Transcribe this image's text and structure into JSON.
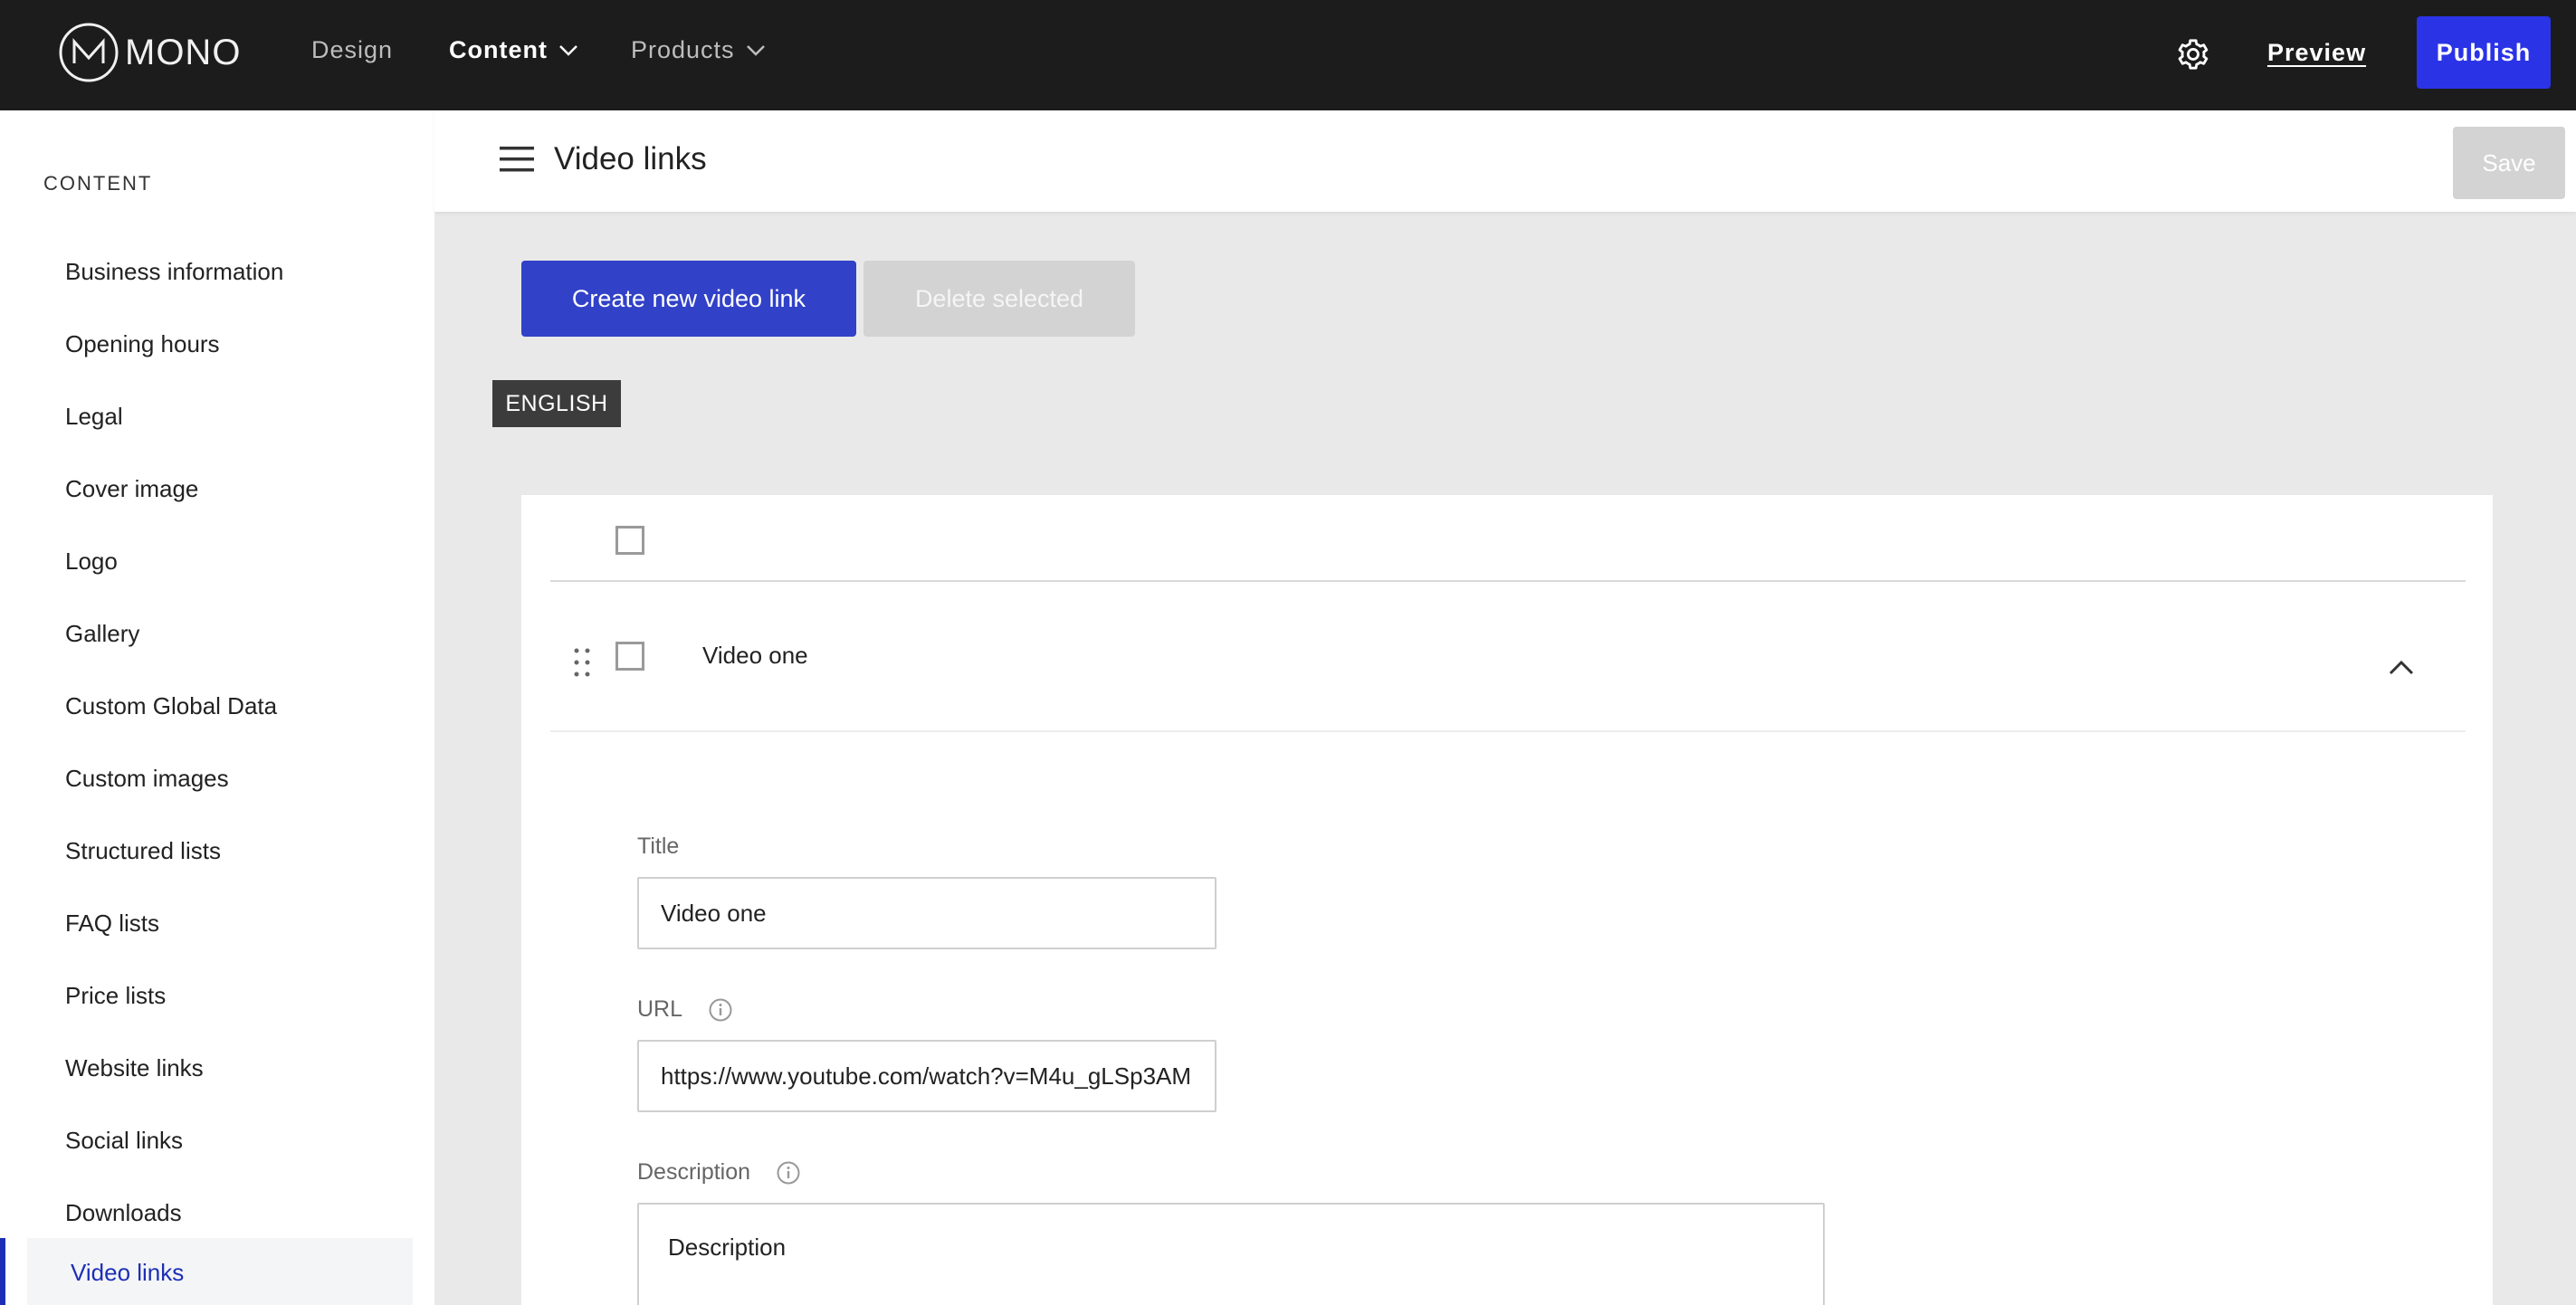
{
  "topbar": {
    "logo_text": "MONO",
    "nav": [
      {
        "label": "Design",
        "active": false,
        "dropdown": false
      },
      {
        "label": "Content",
        "active": true,
        "dropdown": true
      },
      {
        "label": "Products",
        "active": false,
        "dropdown": true
      }
    ],
    "settings_icon": "gear-icon",
    "preview_label": "Preview",
    "publish_label": "Publish",
    "publish_color": "#2b33e6"
  },
  "sidebar": {
    "heading": "CONTENT",
    "items": [
      {
        "label": "Business information"
      },
      {
        "label": "Opening hours"
      },
      {
        "label": "Legal"
      },
      {
        "label": "Cover image"
      },
      {
        "label": "Logo"
      },
      {
        "label": "Gallery"
      },
      {
        "label": "Custom Global Data"
      },
      {
        "label": "Custom images"
      },
      {
        "label": "Structured lists"
      },
      {
        "label": "FAQ lists"
      },
      {
        "label": "Price lists"
      },
      {
        "label": "Website links"
      },
      {
        "label": "Social links"
      },
      {
        "label": "Downloads"
      },
      {
        "label": "Video links",
        "active": true
      }
    ],
    "active_color": "#1d2fb5"
  },
  "header": {
    "title": "Video links",
    "save_label": "Save"
  },
  "actions": {
    "create_label": "Create new video link",
    "delete_label": "Delete selected",
    "create_color": "#3141c8"
  },
  "language_tab": "ENGLISH",
  "video_item": {
    "title": "Video one",
    "fields": {
      "title_label": "Title",
      "title_value": "Video one",
      "url_label": "URL",
      "url_value": "https://www.youtube.com/watch?v=M4u_gLSp3AM",
      "description_label": "Description",
      "description_value": "Description"
    }
  }
}
